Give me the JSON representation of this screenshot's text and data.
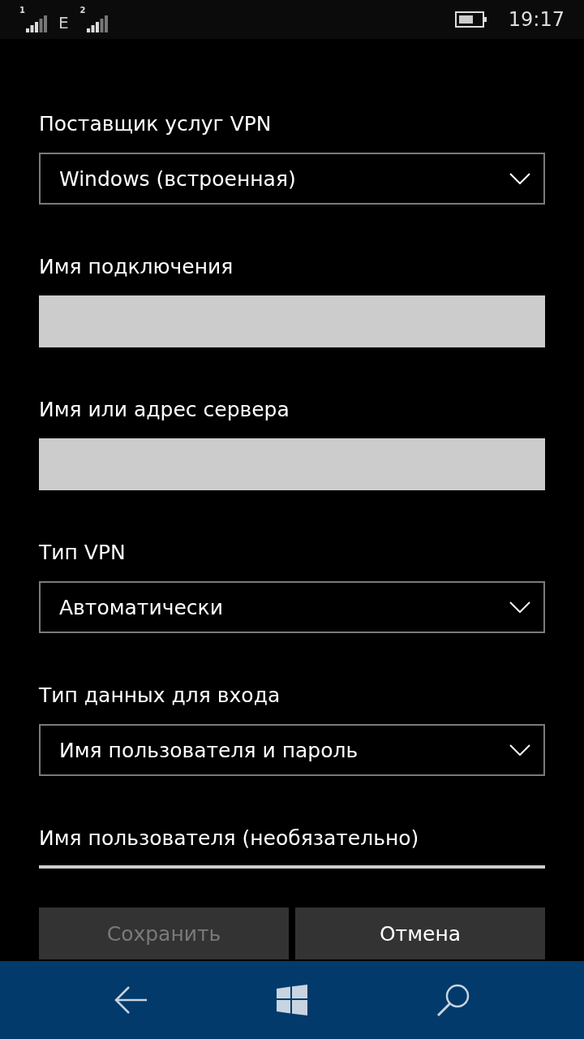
{
  "status_bar": {
    "sim_1": "1",
    "network_type": "E",
    "sim_2": "2",
    "time": "19:17"
  },
  "fields": [
    {
      "kind": "dropdown",
      "label": "Поставщик услуг VPN",
      "value": "Windows (встроенная)"
    },
    {
      "kind": "text",
      "label": "Имя подключения"
    },
    {
      "kind": "text",
      "label": "Имя или адрес сервера"
    },
    {
      "kind": "dropdown",
      "label": "Тип VPN",
      "value": "Автоматически"
    },
    {
      "kind": "dropdown",
      "label": "Тип данных для входа",
      "value": "Имя пользователя и пароль"
    },
    {
      "kind": "partial",
      "label": "Имя пользователя (необязательно)"
    }
  ],
  "buttons": [
    {
      "label": "Сохранить",
      "disabled": true
    },
    {
      "label": "Отмена",
      "disabled": false
    }
  ]
}
